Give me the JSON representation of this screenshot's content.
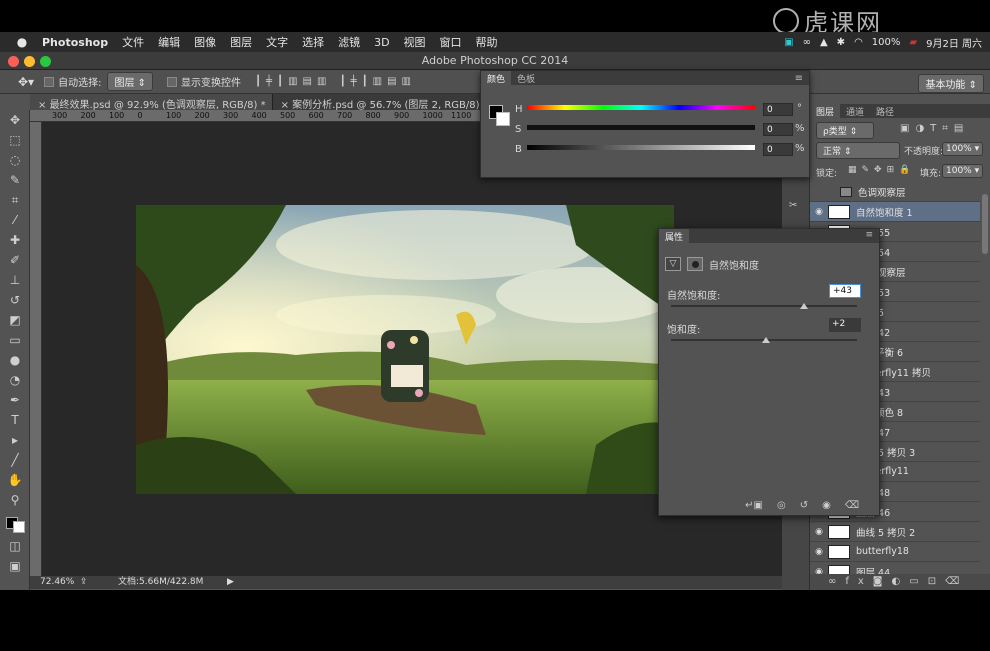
{
  "menubar": {
    "app_name": "Photoshop",
    "items": [
      "文件",
      "编辑",
      "图像",
      "图层",
      "文字",
      "选择",
      "滤镜",
      "3D",
      "视图",
      "窗口",
      "帮助"
    ],
    "battery": "100%",
    "date": "9月2日 周六"
  },
  "window": {
    "title": "Adobe Photoshop CC 2014"
  },
  "options": {
    "auto_select_label": "自动选择:",
    "auto_select_value": "图层",
    "show_transform_label": "显示变换控件",
    "workspace": "基本功能"
  },
  "tabs": [
    {
      "label": "最终效果.psd @ 92.9% (色调观察层, RGB/8) *"
    },
    {
      "label": "案例分析.psd @ 56.7% (图层 2, RGB/8) *"
    },
    {
      "label": "实"
    }
  ],
  "ruler": [
    "300",
    "200",
    "100",
    "0",
    "100",
    "200",
    "300",
    "400",
    "500",
    "600",
    "700",
    "800",
    "900",
    "1000",
    "1100",
    "12"
  ],
  "status": {
    "zoom": "72.46%",
    "doc": "文档:5.66M/422.8M"
  },
  "color_panel": {
    "tabs": [
      "颜色",
      "色板"
    ],
    "channels": [
      {
        "label": "H",
        "value": "0",
        "unit": "°"
      },
      {
        "label": "S",
        "value": "0",
        "unit": "%"
      },
      {
        "label": "B",
        "value": "0",
        "unit": "%"
      }
    ]
  },
  "properties_panel": {
    "tab": "属性",
    "title": "自然饱和度",
    "vibrance_label": "自然饱和度:",
    "vibrance_value": "+43",
    "vibrance_level": 43,
    "saturation_label": "饱和度:",
    "saturation_value": "+2",
    "saturation_level": 2
  },
  "layers_panel": {
    "tabs": [
      "图层",
      "通道",
      "路径"
    ],
    "kind": "ρ类型",
    "blend_mode": "正常",
    "opacity_label": "不透明度:",
    "opacity": "100%",
    "lock_label": "锁定:",
    "fill_label": "填充:",
    "fill": "100%",
    "layers": [
      {
        "name": "色调观察层"
      },
      {
        "name": "自然饱和度 1"
      },
      {
        "name": "图层 55"
      },
      {
        "name": "图层 54"
      },
      {
        "name": "色调观察层"
      },
      {
        "name": "图层 53"
      },
      {
        "name": "曲线 5"
      },
      {
        "name": "图层 42"
      },
      {
        "name": "色彩平衡 6"
      },
      {
        "name": "butterfly11 拷贝"
      },
      {
        "name": "图层 43"
      },
      {
        "name": "选取颜色 8"
      },
      {
        "name": "图层 47"
      },
      {
        "name": "曲线 5 拷贝 3"
      },
      {
        "name": "butterfly11"
      },
      {
        "name": "图层 48"
      },
      {
        "name": "图层 46"
      },
      {
        "name": "曲线 5 拷贝 2"
      },
      {
        "name": "butterfly18"
      },
      {
        "name": "图层 44"
      }
    ]
  },
  "colors": {
    "accent_red": "#e03a3a",
    "panel": "#535353",
    "selected_row": "#5f6f86"
  }
}
